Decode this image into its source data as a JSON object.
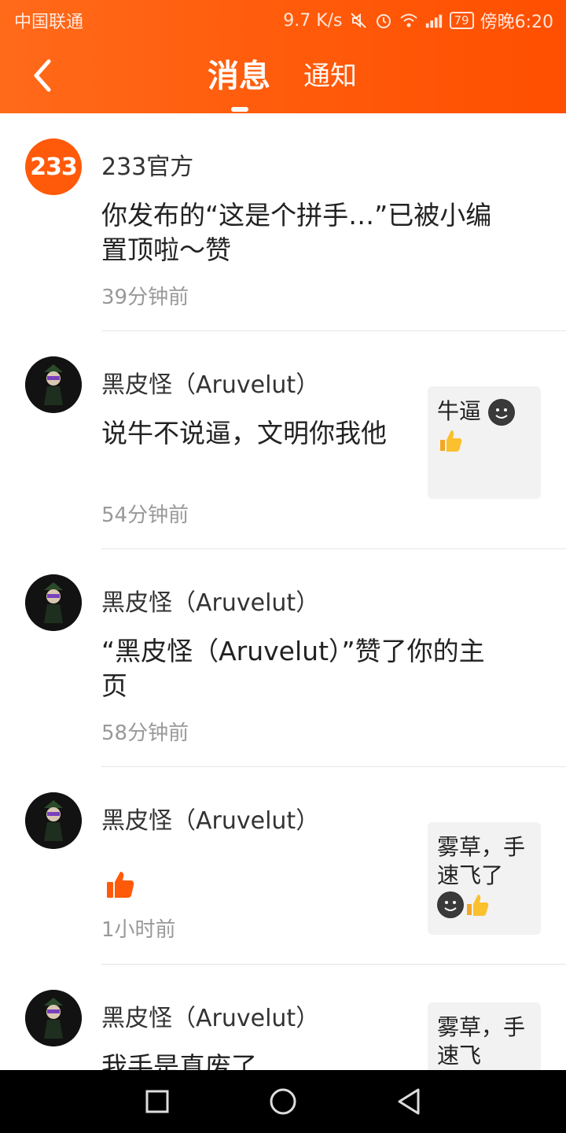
{
  "status_bar": {
    "carrier": "中国联通",
    "network_speed": "9.7 K/s",
    "battery": "79",
    "time": "傍晚6:20"
  },
  "header": {
    "tabs": [
      {
        "label": "消息",
        "active": true
      },
      {
        "label": "通知",
        "active": false
      }
    ],
    "accent_color": "#ff5a0a"
  },
  "messages": [
    {
      "avatar_text": "233",
      "name": "233官方",
      "content": "你发布的“这是个拼手…”已被小编置顶啦～赞",
      "time": "39分钟前"
    },
    {
      "name": "黑皮怪（Aruvelut）",
      "content": "说牛不说逼，文明你我他",
      "time": "54分钟前",
      "quote": "牛逼"
    },
    {
      "name": "黑皮怪（Aruvelut）",
      "content": "“黑皮怪（Aruvelut）”赞了你的主页",
      "time": "58分钟前"
    },
    {
      "name": "黑皮怪（Aruvelut）",
      "time": "1小时前",
      "quote": "雾草，手速飞了"
    },
    {
      "name": "黑皮怪（Aruvelut）",
      "content": "我手是真废了",
      "quote": "雾草，手速飞"
    }
  ]
}
